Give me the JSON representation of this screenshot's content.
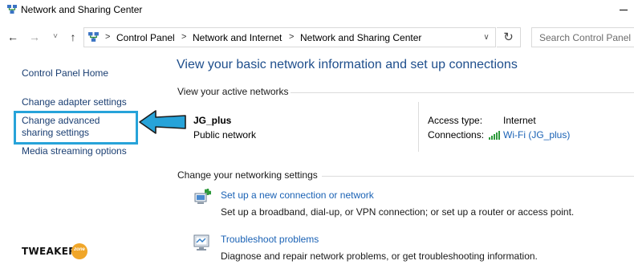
{
  "window": {
    "title": "Network and Sharing Center"
  },
  "nav": {
    "breadcrumbs": [
      "Control Panel",
      "Network and Internet",
      "Network and Sharing Center"
    ],
    "search_placeholder": "Search Control Panel",
    "back_icon": "←",
    "forward_icon": "→",
    "recent_icon": "˅",
    "up_icon": "↑",
    "separator_icon": ">",
    "dropdown_icon": "∨",
    "refresh_icon": "↻"
  },
  "sidebar": {
    "items": [
      {
        "label": "Control Panel Home"
      },
      {
        "label": "Change adapter settings"
      },
      {
        "label": "Change advanced sharing settings"
      },
      {
        "label": "Media streaming options"
      }
    ],
    "highlighted_item": "Change advanced sharing settings",
    "highlight_color": "#27a3d9"
  },
  "main": {
    "heading": "View your basic network information and set up connections",
    "active_networks_label": "View your active networks",
    "network": {
      "name": "JG_plus",
      "type": "Public network",
      "access_type_label": "Access type:",
      "access_type_value": "Internet",
      "connections_label": "Connections:",
      "connections_value": "Wi-Fi (JG_plus)"
    },
    "change_settings_label": "Change your networking settings",
    "tasks": [
      {
        "icon": "new-connection-icon",
        "title": "Set up a new connection or network",
        "description": "Set up a broadband, dial-up, or VPN connection; or set up a router or access point."
      },
      {
        "icon": "troubleshoot-icon",
        "title": "Troubleshoot problems",
        "description": "Diagnose and repair network problems, or get troubleshooting information."
      }
    ]
  },
  "watermark": {
    "brand": "TWEAKER",
    "badge": "zone"
  },
  "colors": {
    "link": "#1a62b5",
    "sidebar_link": "#1a3e72",
    "heading": "#1e4e8c",
    "highlight": "#27a3d9",
    "logo_badge": "#f0a629"
  }
}
